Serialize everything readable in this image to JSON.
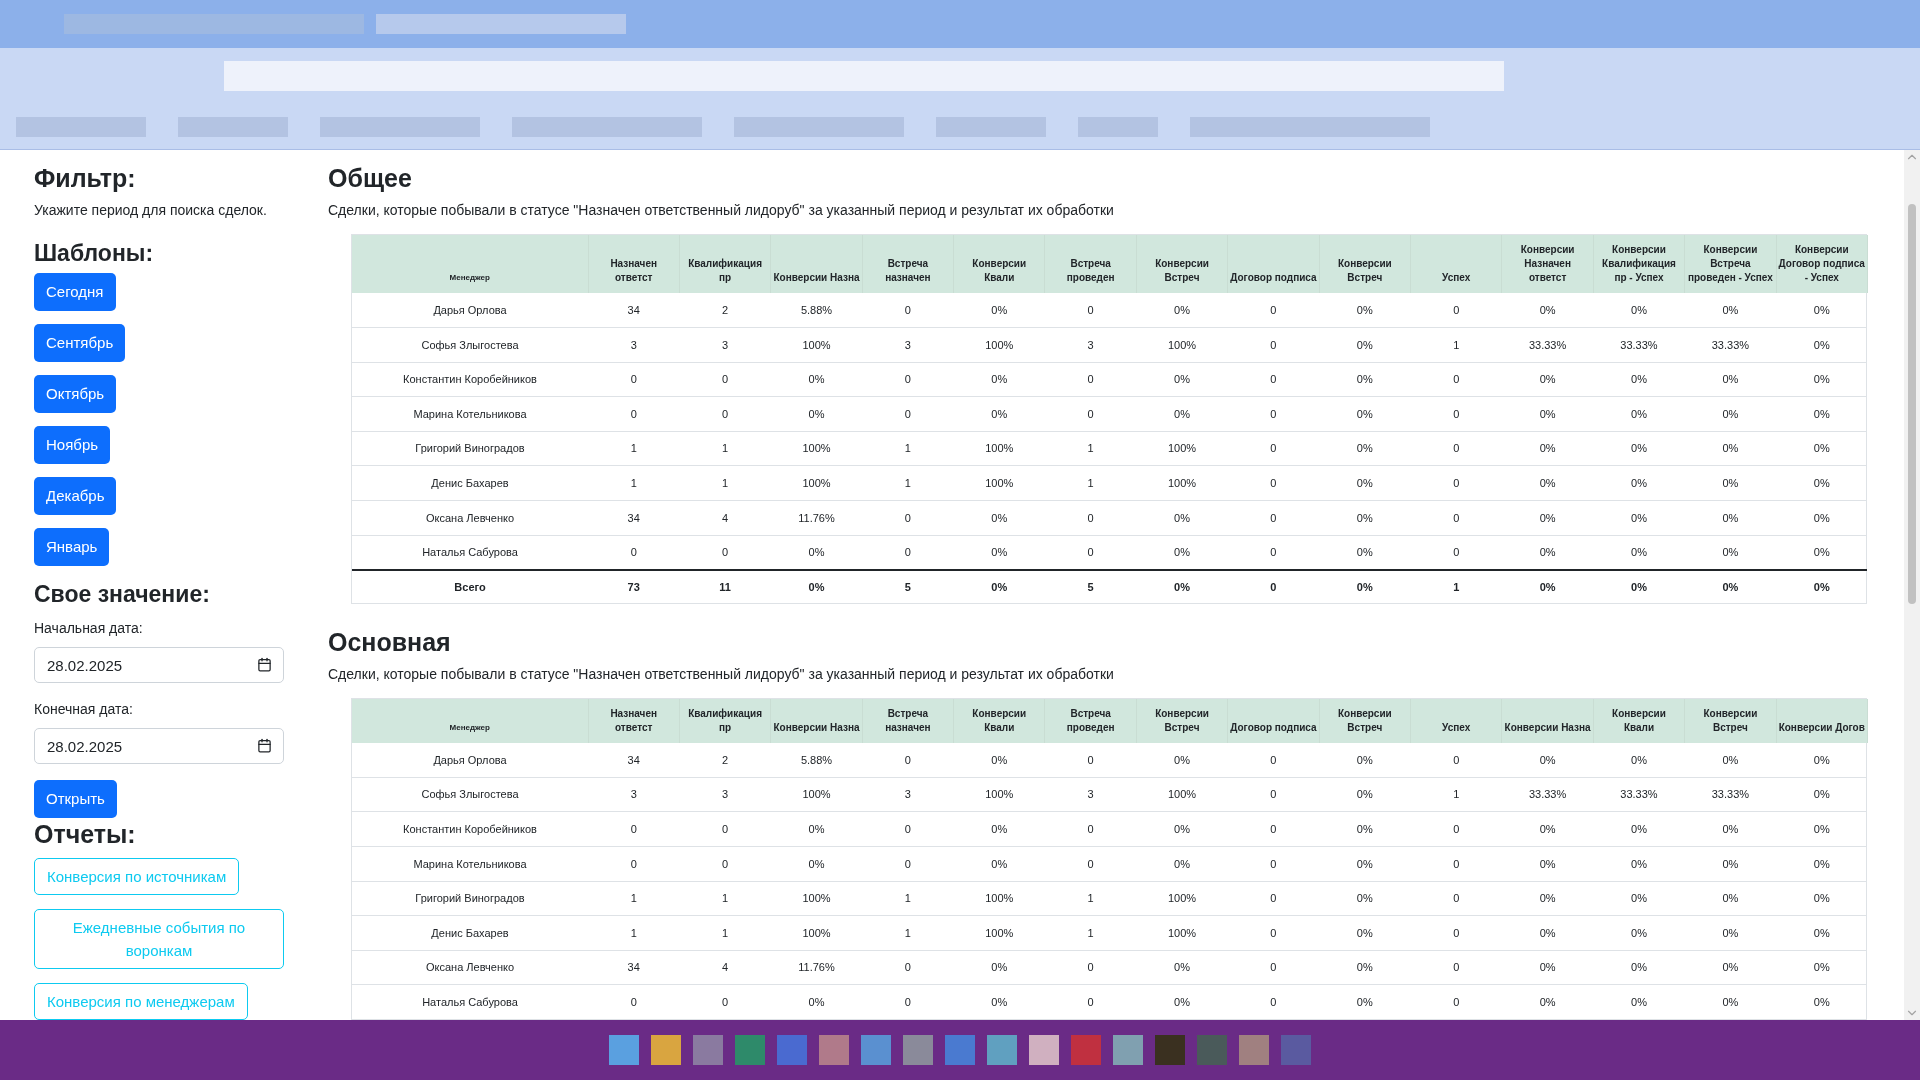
{
  "sidebar": {
    "title": "Фильтр:",
    "hint": "Укажите период для поиска сделок.",
    "templates_title": "Шаблоны:",
    "templates": [
      "Сегодня",
      "Сентябрь",
      "Октябрь",
      "Ноябрь",
      "Декабрь",
      "Январь"
    ],
    "custom_title": "Свое значение:",
    "start_label": "Начальная дата:",
    "start_value": "28.02.2025",
    "end_label": "Конечная дата:",
    "end_value": "28.02.2025",
    "open_button": "Открыть",
    "reports_title": "Отчеты:",
    "reports": [
      "Конверсия по источникам",
      "Ежедневные события по воронкам",
      "Конверсия по менеджерам"
    ]
  },
  "sections": [
    {
      "title": "Общее",
      "description": "Сделки, которые побывали в статусе \"Назначен ответственный лидоруб\" за указанный период и результат их обработки",
      "table": {
        "columns": [
          "Менеджер",
          "Назначен ответст",
          "Квалификация пр",
          "Конверсии Назна",
          "Встреча назначен",
          "Конверсии Квали",
          "Встреча проведен",
          "Конверсии Встреч",
          "Договор подписа",
          "Конверсии Встреч",
          "Успех",
          "Конверсии Назначен ответст",
          "Конверсии Квалификация пр - Успех",
          "Конверсии Встреча проведен - Успех",
          "Конверсии Договор подписа - Успех"
        ],
        "rows": [
          [
            "Дарья Орлова",
            "34",
            "2",
            "5.88%",
            "0",
            "0%",
            "0",
            "0%",
            "0",
            "0%",
            "0",
            "0%",
            "0%",
            "0%",
            "0%"
          ],
          [
            "Софья Злыгостева",
            "3",
            "3",
            "100%",
            "3",
            "100%",
            "3",
            "100%",
            "0",
            "0%",
            "1",
            "33.33%",
            "33.33%",
            "33.33%",
            "0%"
          ],
          [
            "Константин Коробейников",
            "0",
            "0",
            "0%",
            "0",
            "0%",
            "0",
            "0%",
            "0",
            "0%",
            "0",
            "0%",
            "0%",
            "0%",
            "0%"
          ],
          [
            "Марина Котельникова",
            "0",
            "0",
            "0%",
            "0",
            "0%",
            "0",
            "0%",
            "0",
            "0%",
            "0",
            "0%",
            "0%",
            "0%",
            "0%"
          ],
          [
            "Григорий Виноградов",
            "1",
            "1",
            "100%",
            "1",
            "100%",
            "1",
            "100%",
            "0",
            "0%",
            "0",
            "0%",
            "0%",
            "0%",
            "0%"
          ],
          [
            "Денис Бахарев",
            "1",
            "1",
            "100%",
            "1",
            "100%",
            "1",
            "100%",
            "0",
            "0%",
            "0",
            "0%",
            "0%",
            "0%",
            "0%"
          ],
          [
            "Оксана Левченко",
            "34",
            "4",
            "11.76%",
            "0",
            "0%",
            "0",
            "0%",
            "0",
            "0%",
            "0",
            "0%",
            "0%",
            "0%",
            "0%"
          ],
          [
            "Наталья Сабурова",
            "0",
            "0",
            "0%",
            "0",
            "0%",
            "0",
            "0%",
            "0",
            "0%",
            "0",
            "0%",
            "0%",
            "0%",
            "0%"
          ]
        ],
        "total": [
          "Всего",
          "73",
          "11",
          "0%",
          "5",
          "0%",
          "5",
          "0%",
          "0",
          "0%",
          "1",
          "0%",
          "0%",
          "0%",
          "0%"
        ]
      }
    },
    {
      "title": "Основная",
      "description": "Сделки, которые побывали в статусе \"Назначен ответственный лидоруб\" за указанный период и результат их обработки",
      "table": {
        "columns": [
          "Менеджер",
          "Назначен ответст",
          "Квалификация пр",
          "Конверсии Назна",
          "Встреча назначен",
          "Конверсии Квали",
          "Встреча проведен",
          "Конверсии Встреч",
          "Договор подписа",
          "Конверсии Встреч",
          "Успех",
          "Конверсии Назна",
          "Конверсии Квали",
          "Конверсии Встреч",
          "Конверсии Догов"
        ],
        "rows": [
          [
            "Дарья Орлова",
            "34",
            "2",
            "5.88%",
            "0",
            "0%",
            "0",
            "0%",
            "0",
            "0%",
            "0",
            "0%",
            "0%",
            "0%",
            "0%"
          ],
          [
            "Софья Злыгостева",
            "3",
            "3",
            "100%",
            "3",
            "100%",
            "3",
            "100%",
            "0",
            "0%",
            "1",
            "33.33%",
            "33.33%",
            "33.33%",
            "0%"
          ],
          [
            "Константин Коробейников",
            "0",
            "0",
            "0%",
            "0",
            "0%",
            "0",
            "0%",
            "0",
            "0%",
            "0",
            "0%",
            "0%",
            "0%",
            "0%"
          ],
          [
            "Марина Котельникова",
            "0",
            "0",
            "0%",
            "0",
            "0%",
            "0",
            "0%",
            "0",
            "0%",
            "0",
            "0%",
            "0%",
            "0%",
            "0%"
          ],
          [
            "Григорий Виноградов",
            "1",
            "1",
            "100%",
            "1",
            "100%",
            "1",
            "100%",
            "0",
            "0%",
            "0",
            "0%",
            "0%",
            "0%",
            "0%"
          ],
          [
            "Денис Бахарев",
            "1",
            "1",
            "100%",
            "1",
            "100%",
            "1",
            "100%",
            "0",
            "0%",
            "0",
            "0%",
            "0%",
            "0%",
            "0%"
          ],
          [
            "Оксана Левченко",
            "34",
            "4",
            "11.76%",
            "0",
            "0%",
            "0",
            "0%",
            "0",
            "0%",
            "0",
            "0%",
            "0%",
            "0%",
            "0%"
          ],
          [
            "Наталья Сабурова",
            "0",
            "0",
            "0%",
            "0",
            "0%",
            "0",
            "0%",
            "0",
            "0%",
            "0",
            "0%",
            "0%",
            "0%",
            "0%"
          ]
        ]
      }
    }
  ]
}
